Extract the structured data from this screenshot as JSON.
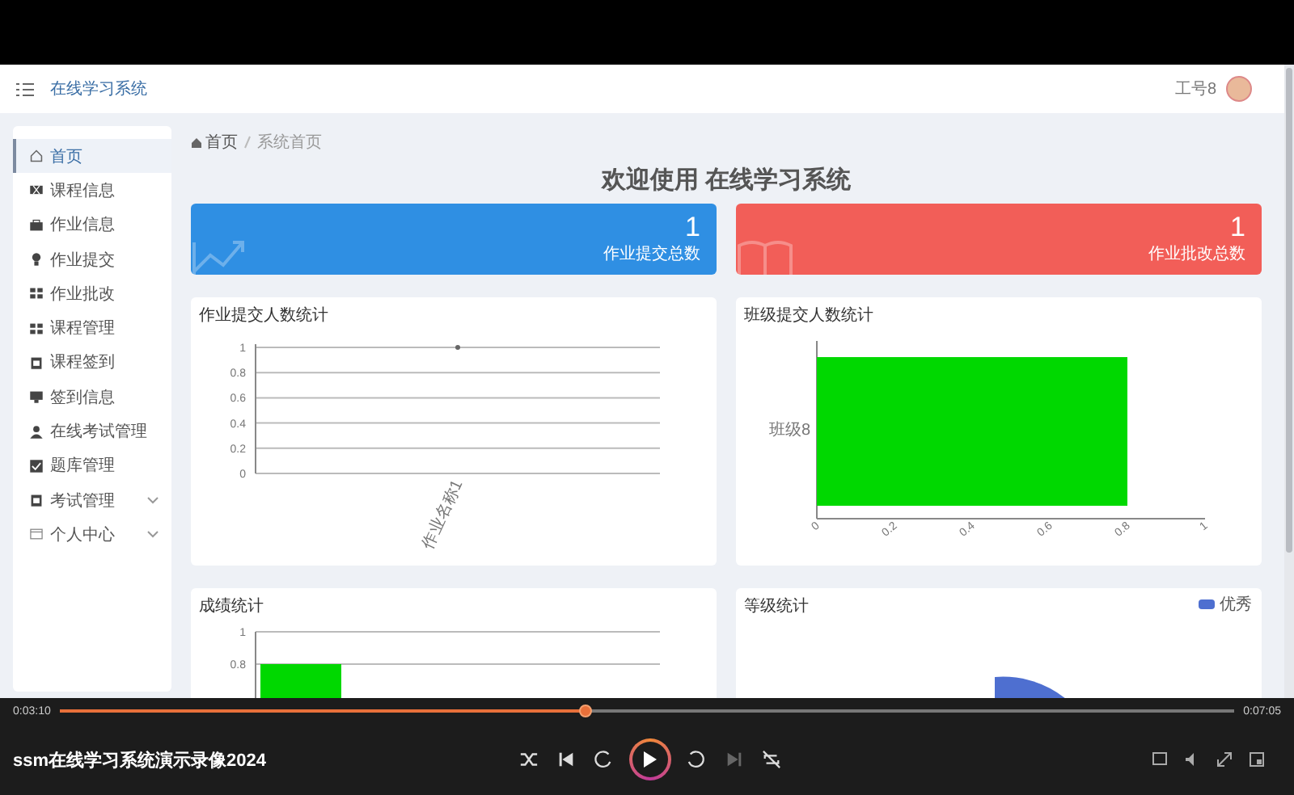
{
  "header": {
    "title": "在线学习系统",
    "user": "工号8"
  },
  "sidebar": {
    "items": [
      {
        "label": "首页",
        "selected": true,
        "kind": "link"
      },
      {
        "label": "课程信息",
        "selected": false,
        "kind": "link"
      },
      {
        "label": "作业信息",
        "selected": false,
        "kind": "link"
      },
      {
        "label": "作业提交",
        "selected": false,
        "kind": "link"
      },
      {
        "label": "作业批改",
        "selected": false,
        "kind": "link"
      },
      {
        "label": "课程管理",
        "selected": false,
        "kind": "link"
      },
      {
        "label": "课程签到",
        "selected": false,
        "kind": "link"
      },
      {
        "label": "签到信息",
        "selected": false,
        "kind": "link"
      },
      {
        "label": "在线考试管理",
        "selected": false,
        "kind": "link"
      },
      {
        "label": "题库管理",
        "selected": false,
        "kind": "link"
      },
      {
        "label": "考试管理",
        "selected": false,
        "kind": "submenu"
      },
      {
        "label": "个人中心",
        "selected": false,
        "kind": "submenu"
      }
    ]
  },
  "breadcrumb": [
    "首页",
    "系统首页"
  ],
  "welcome": "欢迎使用 在线学习系统",
  "stats": [
    {
      "value": "1",
      "label": "作业提交总数",
      "color": "#2f8fe3"
    },
    {
      "value": "1",
      "label": "作业批改总数",
      "color": "#f25e58"
    }
  ],
  "charts": [
    {
      "chart_data": {
        "type": "line",
        "title": "作业提交人数统计",
        "categories": [
          "作业名称1"
        ],
        "series": [
          {
            "color": "#666666",
            "values": [
              1
            ],
            "marker": true
          }
        ],
        "grid": true,
        "ylim": [
          0,
          1
        ],
        "yticks": [
          0,
          0.2,
          0.4,
          0.6,
          0.8,
          1
        ]
      }
    },
    {
      "chart_data": {
        "type": "bar",
        "orientation": "horizontal",
        "title": "班级提交人数统计",
        "categories": [
          "班级8"
        ],
        "series": [
          {
            "color": "#00d800",
            "values": [
              0.8
            ]
          }
        ],
        "xlim": [
          0,
          1
        ],
        "xticks": [
          0,
          0.2,
          0.4,
          0.6,
          0.8,
          1
        ]
      }
    },
    {
      "chart_data": {
        "type": "bar",
        "title": "成绩统计",
        "series": [
          {
            "color": "#00d800",
            "values": [
              0.8
            ]
          }
        ],
        "ylim": [
          0,
          1
        ],
        "yticks": [
          0.8,
          1
        ]
      }
    }
  ],
  "grade_panel": {
    "title": "等级统计",
    "legend": [
      {
        "label": "优秀",
        "color": "#4e6fd0"
      }
    ]
  },
  "player": {
    "current_time": "0:03:10",
    "total_time": "0:07:05",
    "progress": {
      "level": 0.447
    },
    "title": "ssm在线学习系统演示录像2024",
    "controls": [
      {
        "kind": "shuffle",
        "disabled": false
      },
      {
        "kind": "previous",
        "disabled": false
      },
      {
        "kind": "rewind",
        "disabled": false
      },
      {
        "kind": "play",
        "disabled": false
      },
      {
        "kind": "forward",
        "disabled": false
      },
      {
        "kind": "next",
        "disabled": true
      },
      {
        "kind": "repeat",
        "disabled": false
      }
    ]
  }
}
